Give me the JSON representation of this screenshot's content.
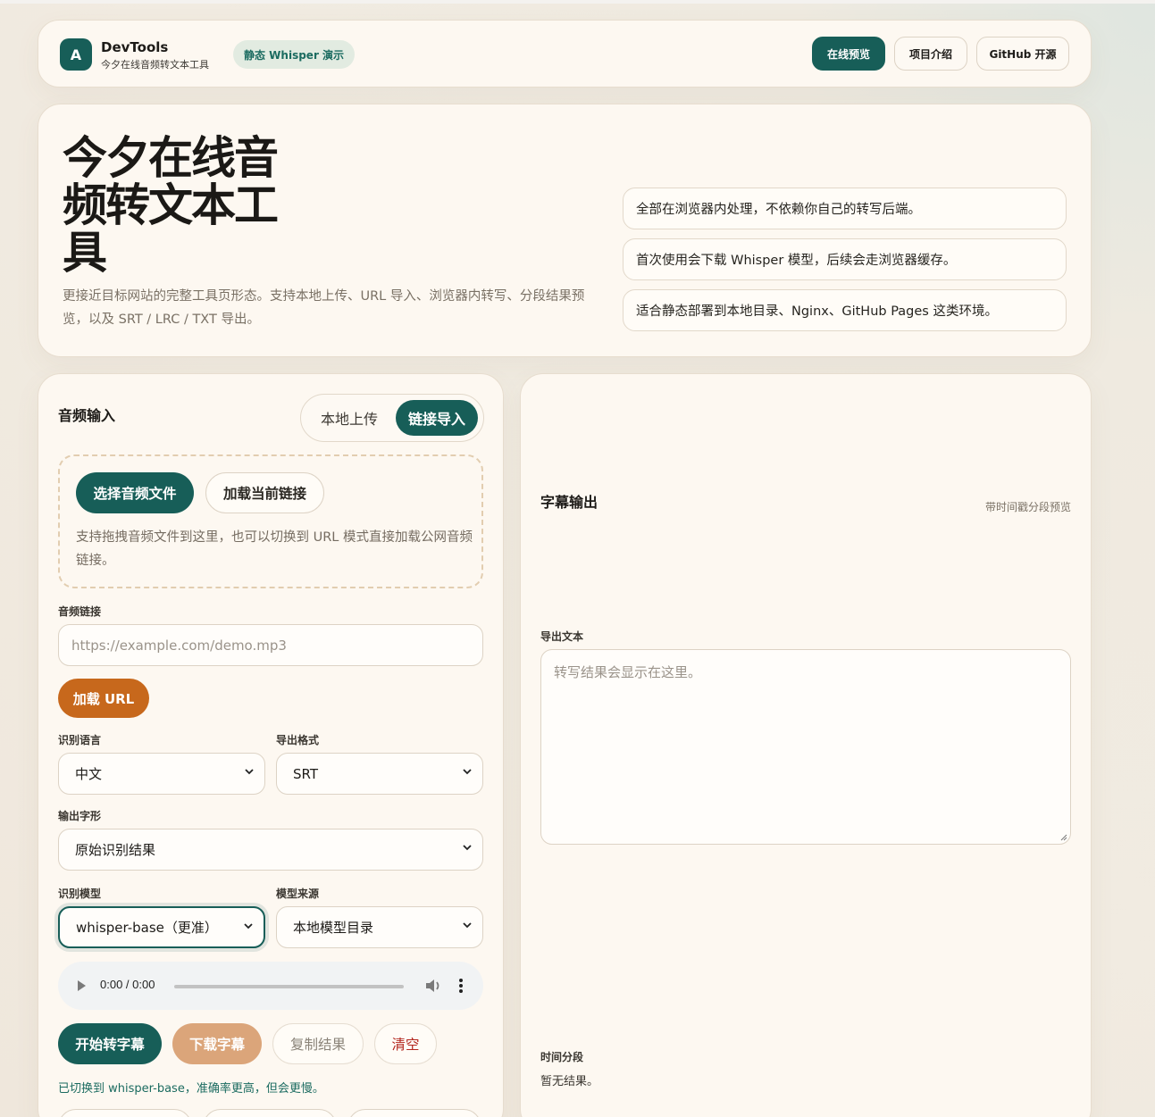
{
  "header": {
    "logo_letter": "A",
    "brand_title": "DevTools",
    "brand_subtitle": "今夕在线音频转文本工具",
    "tag": "静态 Whisper 演示",
    "nav": [
      "在线预览",
      "项目介绍",
      "GitHub 开源"
    ]
  },
  "hero": {
    "title": "今夕在线音频转文本工具",
    "description": "更接近目标网站的完整工具页形态。支持本地上传、URL 导入、浏览器内转写、分段结果预览，以及 SRT / LRC / TXT 导出。",
    "notes": [
      "全部在浏览器内处理，不依赖你自己的转写后端。",
      "首次使用会下载 Whisper 模型，后续会走浏览器缓存。",
      "适合静态部署到本地目录、Nginx、GitHub Pages 这类环境。"
    ]
  },
  "input_panel": {
    "title": "音频输入",
    "mode_tabs": [
      "本地上传",
      "链接导入"
    ],
    "active_mode": "链接导入",
    "choose_file_label": "选择音频文件",
    "load_link_label": "加载当前链接",
    "drop_hint": "支持拖拽音频文件到这里，也可以切换到 URL 模式直接加载公网音频链接。",
    "url_label": "音频链接",
    "url_placeholder": "https://example.com/demo.mp3",
    "load_url_button": "加载 URL",
    "language_label": "识别语言",
    "language_value": "中文",
    "format_label": "导出格式",
    "format_value": "SRT",
    "script_label": "输出字形",
    "script_value": "原始识别结果",
    "model_label": "识别模型",
    "model_value": "whisper-base（更准）",
    "source_label": "模型来源",
    "source_value": "本地模型目录",
    "audio_time": "0:00 / 0:00",
    "actions": [
      "开始转字幕",
      "下载字幕",
      "复制结果",
      "清空"
    ],
    "status": "已切换到 whisper-base，准确率更高，但会更慢。"
  },
  "output_panel": {
    "title": "字幕输出",
    "subtitle_note": "带时间戳分段预览",
    "export_label": "导出文本",
    "export_placeholder": "转写结果会显示在这里。",
    "segments_label": "时间分段",
    "segments_empty": "暂无结果。"
  },
  "colors": {
    "primary": "#175e58",
    "accent_orange": "#c7681c",
    "disabled_orange": "#dba57a",
    "danger": "#b3261e",
    "background": "#f1ebe1",
    "card": "#fdf8f1"
  }
}
